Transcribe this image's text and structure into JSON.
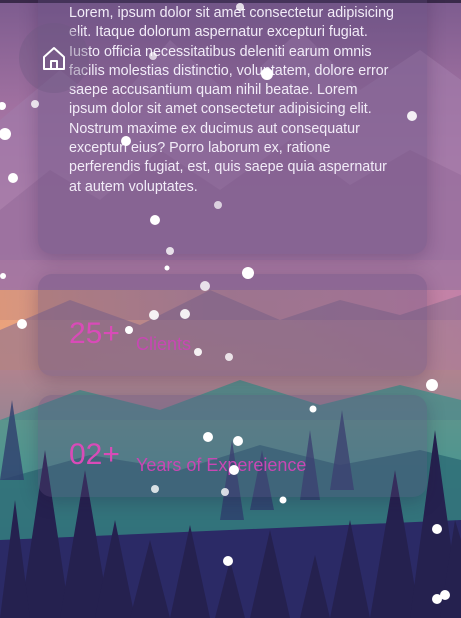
{
  "about": {
    "text": "Lorem, ipsum dolor sit amet consectetur adipisicing elit. Itaque dolorum aspernatur excepturi fugiat. Iusto officia necessitatibus deleniti earum omnis facilis molestias distinctio, voluptatem, dolore error saepe accusantium quam nihil beatae. Lorem ipsum dolor sit amet consectetur adipisicing elit. Nostrum maxime ex ducimus aut consequatur excepturi eius? Porro laborum ex, ratione perferendis fugiat, est, quis saepe quia aspernatur at autem voluptates."
  },
  "stats": [
    {
      "number": "25+",
      "label": "Clients"
    },
    {
      "number": "02+",
      "label": "Years of Expereience"
    }
  ],
  "icons": {
    "home": "home-icon"
  },
  "colors": {
    "accent": "#d94bb8",
    "card": "rgba(90,70,120,0.32)"
  }
}
